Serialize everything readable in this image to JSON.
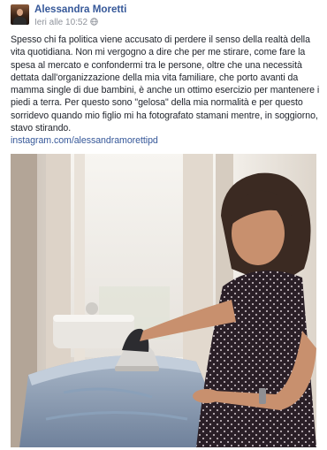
{
  "post": {
    "author": "Alessandra Moretti",
    "timestamp": "Ieri alle 10:52",
    "caption": "Spesso chi fa politica viene accusato di perdere il senso della realtà della vita quotidiana. Non mi vergogno a dire che per me stirare, come fare la spesa al mercato e confondermi tra le persone, oltre che una necessità dettata dall'organizzazione della mia vita familiare, che porto avanti da mamma single di due bambini, è anche un ottimo esercizio per mantenere i piedi a terra. Per questo sono \"gelosa\" della mia normalità e per questo sorridevo quando mio figlio mi ha fotografato stamani mentre, in soggiorno, stavo stirando.",
    "link": "instagram.com/alessandramorettipd",
    "privacy_icon": "globe-icon"
  }
}
